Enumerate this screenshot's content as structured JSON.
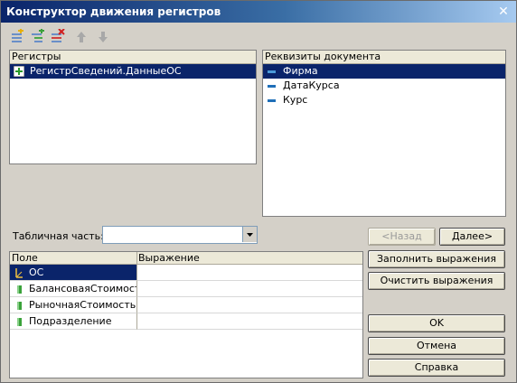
{
  "window": {
    "title": "Конструктор движения регистров",
    "close_glyph": "✕"
  },
  "toolbar": {
    "buttons": [
      {
        "icon": "add-register-icon",
        "enabled": true
      },
      {
        "icon": "add-child-register-icon",
        "enabled": true
      },
      {
        "icon": "delete-register-icon",
        "enabled": true
      },
      {
        "icon": "move-up-icon",
        "enabled": false
      },
      {
        "icon": "move-down-icon",
        "enabled": false
      }
    ]
  },
  "registers_panel": {
    "header": "Регистры",
    "items": [
      {
        "label": "РегистрСведений.ДанныеОС",
        "icon": "plus-icon",
        "selected": true
      }
    ]
  },
  "doc_attrs_panel": {
    "header": "Реквизиты документа",
    "items": [
      {
        "label": "Фирма",
        "icon": "attribute-icon",
        "selected": true
      },
      {
        "label": "ДатаКурса",
        "icon": "attribute-icon",
        "selected": false
      },
      {
        "label": "Курс",
        "icon": "attribute-icon",
        "selected": false
      }
    ]
  },
  "table_part": {
    "label": "Табличная часть:",
    "value": ""
  },
  "buttons": {
    "back": "<Назад",
    "next": "Далее>",
    "fill_expressions": "Заполнить выражения",
    "clear_expressions": "Очистить выражения",
    "ok": "OK",
    "cancel": "Отмена",
    "help": "Справка"
  },
  "grid": {
    "columns": [
      "Поле",
      "Выражение"
    ],
    "rows": [
      {
        "field": "ОС",
        "expression": "",
        "icon": "dimension-icon",
        "selected": true
      },
      {
        "field": "БалансоваяСтоимость",
        "expression": "",
        "icon": "resource-icon",
        "selected": false
      },
      {
        "field": "РыночнаяСтоимость",
        "expression": "",
        "icon": "resource-icon",
        "selected": false
      },
      {
        "field": "Подразделение",
        "expression": "",
        "icon": "resource-icon",
        "selected": false
      }
    ]
  },
  "colors": {
    "title_start": "#0a246a",
    "title_end": "#a6caf0",
    "selection": "#0a246a",
    "window_bg": "#d4d0c8"
  }
}
